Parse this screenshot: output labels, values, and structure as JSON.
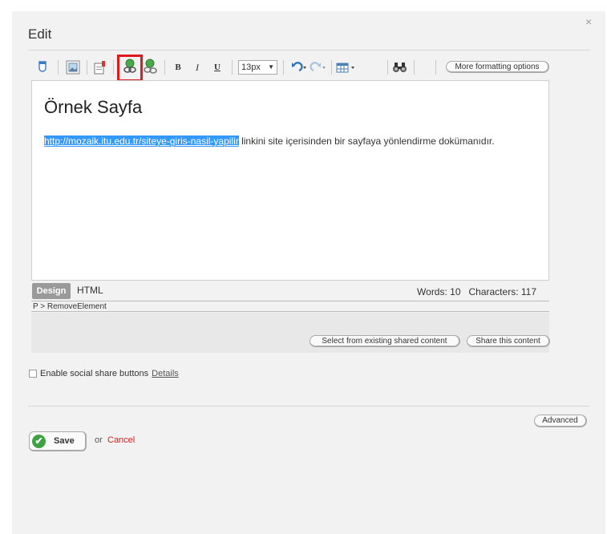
{
  "dialog": {
    "title": "Edit",
    "close_label": "×"
  },
  "toolbar": {
    "font_size": "13px",
    "more_formatting": "More formatting options",
    "bold": "B",
    "italic": "I",
    "underline": "U"
  },
  "editor": {
    "heading": "Örnek Sayfa",
    "selected_link": "http://mozaik.itu.edu.tr/siteye-giris-nasil-yapilir",
    "paragraph_rest": " linkini site içerisinden bir sayfaya yönlendirme dokümanıdır."
  },
  "mode_tabs": {
    "design": "Design",
    "html": "HTML"
  },
  "stats": {
    "text": "Words: 10   Characters: 117"
  },
  "path_bar": "P > RemoveElement",
  "shared": {
    "select_existing": "Select from existing shared content",
    "share_this": "Share this content"
  },
  "social": {
    "label": "Enable social share buttons",
    "details": "Details"
  },
  "advanced": "Advanced",
  "footer": {
    "save": "Save",
    "or": "or",
    "cancel": "Cancel"
  },
  "colors": {
    "selection": "#3399ff",
    "highlight_box": "#e0191f",
    "save_check": "#3fa142",
    "cancel": "#d21f1f"
  }
}
